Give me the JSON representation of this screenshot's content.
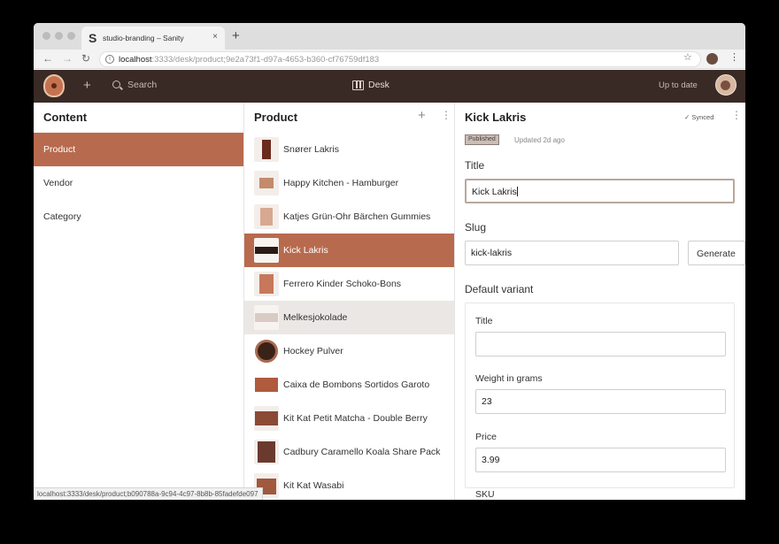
{
  "browser": {
    "tab_title": "studio-branding – Sanity",
    "tab_favicon": "S",
    "tab_close": "×",
    "new_tab": "+",
    "url_host": "localhost",
    "url_path": ":3333/desk/product;9e2a73f1-d97a-4653-b360-cf76759df183",
    "hover_url": "localhost:3333/desk/product;b090788a-9c94-4c97-8b8b-85fadefde097"
  },
  "appbar": {
    "search_label": "Search",
    "desk_label": "Desk",
    "status": "Up to date"
  },
  "content_pane": {
    "title": "Content",
    "items": [
      {
        "label": "Product",
        "active": true
      },
      {
        "label": "Vendor",
        "active": false
      },
      {
        "label": "Category",
        "active": false
      }
    ]
  },
  "product_pane": {
    "title": "Product",
    "items": [
      {
        "label": "Snører Lakris",
        "state": ""
      },
      {
        "label": "Happy Kitchen - Hamburger",
        "state": ""
      },
      {
        "label": "Katjes Grün-Ohr Bärchen Gummies",
        "state": ""
      },
      {
        "label": "Kick Lakris",
        "state": "active"
      },
      {
        "label": "Ferrero Kinder Schoko-Bons",
        "state": ""
      },
      {
        "label": "Melkesjokolade",
        "state": "hover"
      },
      {
        "label": "Hockey Pulver",
        "state": ""
      },
      {
        "label": "Caixa de Bombons Sortidos Garoto",
        "state": ""
      },
      {
        "label": "Kit Kat Petit Matcha - Double Berry",
        "state": ""
      },
      {
        "label": "Cadbury Caramello Koala Share Pack",
        "state": ""
      },
      {
        "label": "Kit Kat Wasabi",
        "state": ""
      }
    ]
  },
  "document": {
    "title": "Kick Lakris",
    "synced": "✓ Synced",
    "badge": "Published",
    "updated": "Updated 2d ago",
    "title_label": "Title",
    "title_value": "Kick Lakris",
    "slug_label": "Slug",
    "slug_value": "kick-lakris",
    "generate_label": "Generate",
    "variant_label": "Default variant",
    "variant": {
      "title_label": "Title",
      "title_value": "",
      "weight_label": "Weight in grams",
      "weight_value": "23",
      "price_label": "Price",
      "price_value": "3.99",
      "sku_label": "SKU"
    }
  },
  "colors": {
    "accent": "#b86a4e",
    "appbar": "#3a2a26"
  }
}
